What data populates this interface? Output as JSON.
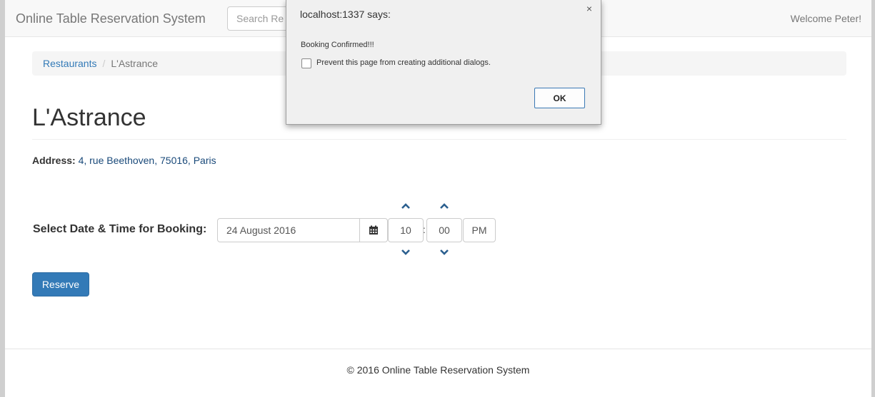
{
  "navbar": {
    "brand": "Online Table Reservation System",
    "search_placeholder": "Search Re",
    "welcome": "Welcome Peter!"
  },
  "breadcrumb": {
    "items": [
      "Restaurants",
      "L'Astrance"
    ],
    "separator": "/"
  },
  "restaurant": {
    "name": "L'Astrance",
    "address_label": "Address:",
    "address_value": "4, rue Beethoven, 75016, Paris"
  },
  "booking": {
    "label": "Select Date & Time for Booking:",
    "date": "24 August 2016",
    "hours": "10",
    "separator": ":",
    "minutes": "00",
    "meridian": "PM",
    "reserve_label": "Reserve",
    "icons": {
      "calendar": "calendar-icon",
      "up": "chevron-up-icon",
      "down": "chevron-down-icon"
    }
  },
  "footer": {
    "text": "© 2016 Online Table Reservation System"
  },
  "dialog": {
    "title": "localhost:1337 says:",
    "message": "Booking Confirmed!!!",
    "checkbox_label": "Prevent this page from creating additional dialogs.",
    "ok_label": "OK",
    "close_glyph": "×"
  },
  "colors": {
    "primary": "#337ab7",
    "link": "#337ab7",
    "navbar_bg": "#f8f8f8",
    "chevron": "#2b5f8f"
  }
}
